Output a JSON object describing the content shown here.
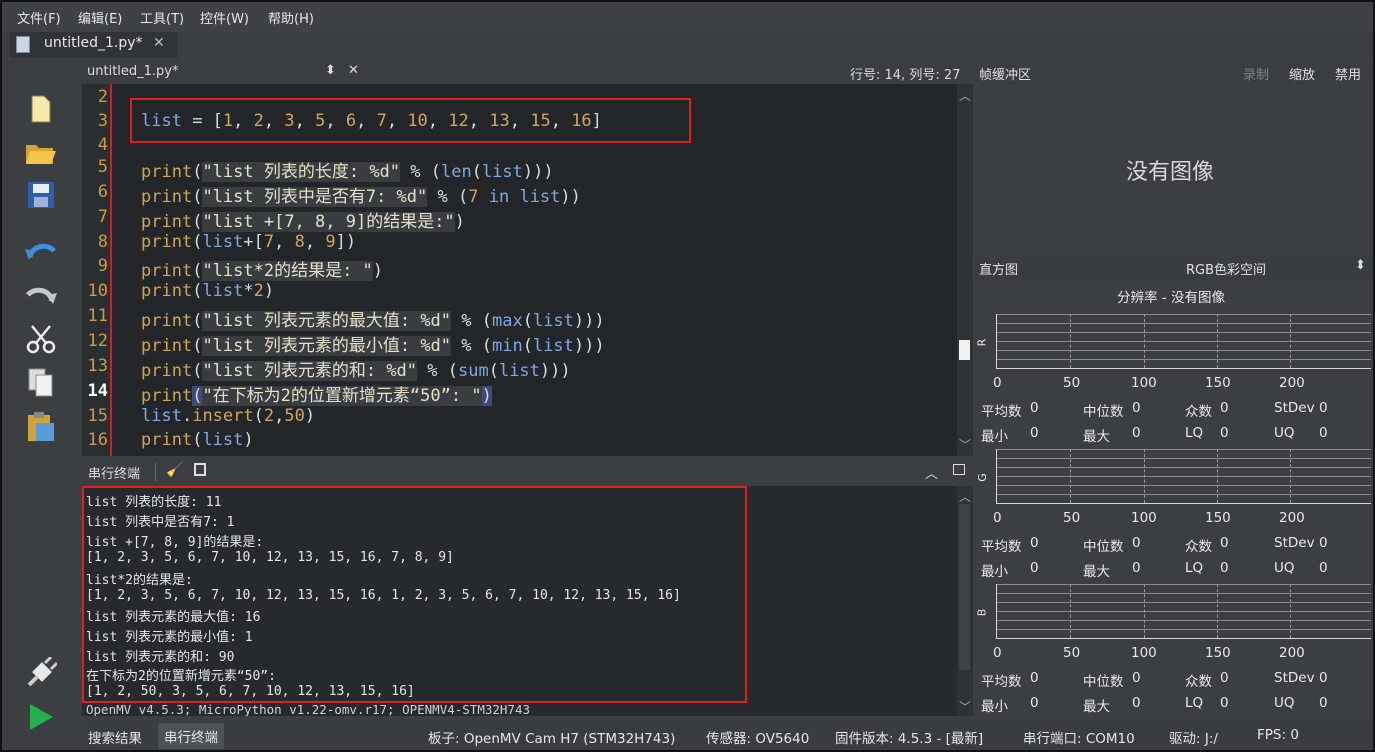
{
  "menu": [
    "文件(F)",
    "编辑(E)",
    "工具(T)",
    "控件(W)",
    "帮助(H)"
  ],
  "file_tab": {
    "name": "untitled_1.py*",
    "close": "✕"
  },
  "editor": {
    "header_file": "untitled_1.py*",
    "header_arrows": "⬍",
    "header_close": "✕",
    "cursor_pos": "行号: 14, 列号: 27",
    "line_numbers": [
      "2",
      "3",
      "4",
      "5",
      "6",
      "7",
      "8",
      "9",
      "10",
      "11",
      "12",
      "13",
      "14",
      "15",
      "16"
    ]
  },
  "serial": {
    "title": "串行终端",
    "lines": [
      "list 列表的长度: 11",
      "list 列表中是否有7: 1",
      "list +[7, 8, 9]的结果是:",
      "[1, 2, 3, 5, 6, 7, 10, 12, 13, 15, 16, 7, 8, 9]",
      "list*2的结果是:",
      "[1, 2, 3, 5, 6, 7, 10, 12, 13, 15, 16, 1, 2, 3, 5, 6, 7, 10, 12, 13, 15, 16]",
      "list 列表元素的最大值: 16",
      "list 列表元素的最小值: 1",
      "list 列表元素的和: 90",
      "在下标为2的位置新增元素“50”:",
      "[1, 2, 50, 3, 5, 6, 7, 10, 12, 13, 15, 16]",
      "OpenMV v4.5.3; MicroPython v1.22-omv.r17; OPENMV4-STM32H743"
    ]
  },
  "framebuffer": {
    "title": "帧缓冲区",
    "record": "录制",
    "zoom": "缩放",
    "disable": "禁用",
    "no_image": "没有图像"
  },
  "histogram": {
    "title": "直方图",
    "colorspace": "RGB色彩空间",
    "colorspace_arrow": "⬍",
    "resolution": "分辨率 - 没有图像",
    "channels": [
      "R",
      "G",
      "B"
    ],
    "ticks": [
      "0",
      "50",
      "100",
      "150",
      "200"
    ],
    "stats_labels": {
      "mean": "平均数",
      "median": "中位数",
      "mode": "众数",
      "stdev": "StDev",
      "min": "最小",
      "max": "最大",
      "lq": "LQ",
      "uq": "UQ"
    },
    "stat_value": "0"
  },
  "bottom_tabs": {
    "search": "搜索结果",
    "serial": "串行终端"
  },
  "status": {
    "board": "板子: OpenMV Cam H7 (STM32H743)",
    "sensor": "传感器: OV5640",
    "firmware": "固件版本: 4.5.3 - [最新]",
    "port": "串行端口: COM10",
    "drive": "驱动: J:/",
    "fps": "FPS: 0"
  }
}
